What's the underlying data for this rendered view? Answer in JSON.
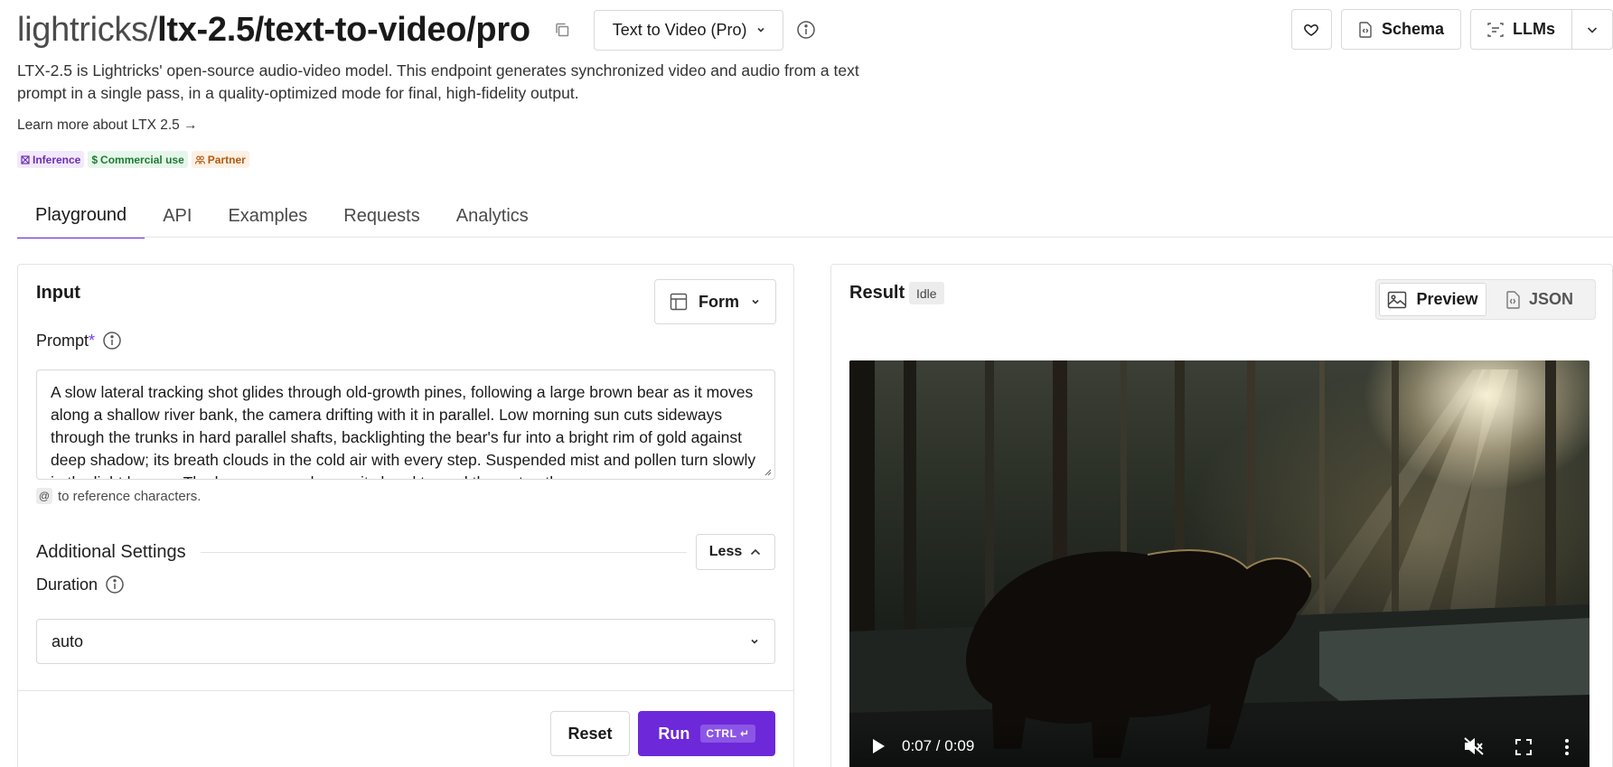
{
  "header": {
    "owner": "lightricks/",
    "model_path": "ltx-2.5/text-to-video/pro",
    "variant": "Text to Video (Pro)",
    "description": "LTX-2.5 is Lightricks' open-source audio-video model. This endpoint generates synchronized video and audio from a text prompt in a single pass, in a quality-optimized mode for final, high-fidelity output.",
    "learn_more": "Learn more about LTX 2.5 →",
    "badges": [
      {
        "label": "Inference",
        "icon": "inference-icon"
      },
      {
        "label": "Commercial use",
        "icon": "dollar-icon"
      },
      {
        "label": "Partner",
        "icon": "partner-icon"
      }
    ],
    "actions": {
      "favorite_icon": "heart-icon",
      "schema": "Schema",
      "llms": "LLMs"
    }
  },
  "tabs": [
    "Playground",
    "API",
    "Examples",
    "Requests",
    "Analytics"
  ],
  "active_tab": "Playground",
  "input": {
    "title": "Input",
    "mode_select": "Form",
    "prompt_label": "Prompt",
    "prompt_required_mark": "*",
    "prompt_value": "A slow lateral tracking shot glides through old-growth pines, following a large brown bear as it moves along a shallow river bank, the camera drifting with it in parallel. Low morning sun cuts sideways through the trunks in hard parallel shafts, backlighting the bear's fur into a bright rim of gold against deep shadow; its breath clouds in the cold air with every step. Suspended mist and pollen turn slowly in the light beams. The bear pauses, lowers its head toward the water, then",
    "hint_chip": "@",
    "hint_text": "to reference characters.",
    "additional_settings": "Additional Settings",
    "less_button": "Less",
    "duration_label": "Duration",
    "duration_value": "auto",
    "reset_button": "Reset",
    "run_button": "Run",
    "run_shortcut": "CTRL ↵"
  },
  "result": {
    "title": "Result",
    "status": "Idle",
    "view_options": [
      "Preview",
      "JSON"
    ],
    "active_view": "Preview",
    "video": {
      "time": "0:07 / 0:09",
      "progress": 0.75
    }
  },
  "colors": {
    "accent": "#6d28d9",
    "inference_badge": "#6b2fb0",
    "commercial_badge": "#1f7a36",
    "partner_badge": "#b45a10"
  }
}
